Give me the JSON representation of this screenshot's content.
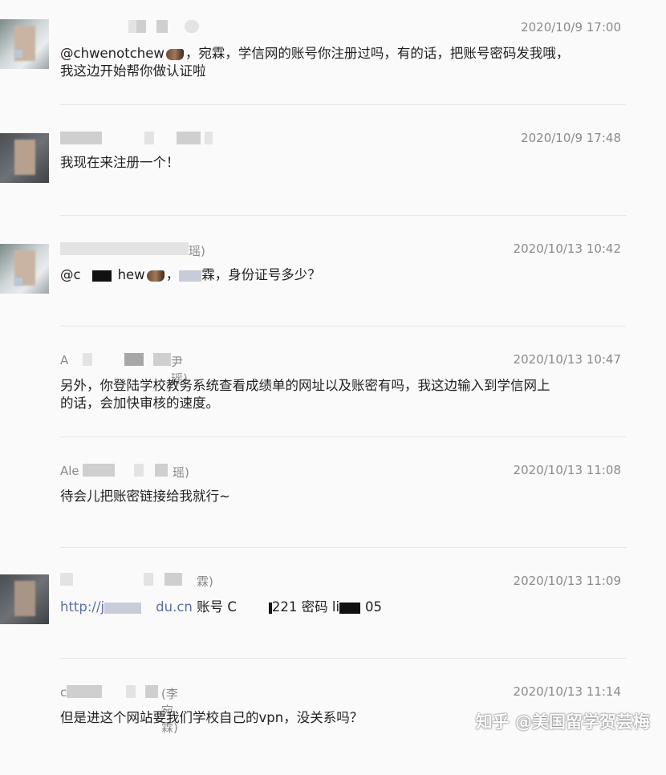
{
  "messages": [
    {
      "time": "2020/10/9 17:00",
      "content_parts": [
        "@chwenotchew",
        "，宛霖，学信网的账号你注册过吗，有的话，把账号密码发我哦，\n我这边开始帮你做认证啦"
      ]
    },
    {
      "time": "2020/10/9 17:48",
      "content": "我现在来注册一个！"
    },
    {
      "sender_visible": "瑶)",
      "time": "2020/10/13 10:42",
      "content_parts": [
        "@c",
        "hew",
        "，",
        "霖，身份证号多少？"
      ]
    },
    {
      "sender_prefix": "A",
      "sender_suffix": "尹瑶)",
      "time": "2020/10/13 10:47",
      "content": "另外，你登陆学校教务系统查看成绩单的网址以及账密有吗，我这边输入到学信网上\n的话，会加快审核的速度。"
    },
    {
      "sender_prefix": "Ale",
      "sender_suffix": "瑶)",
      "time": "2020/10/13 11:08",
      "content": "待会儿把账密链接给我就行~"
    },
    {
      "sender_suffix": "霖)",
      "time": "2020/10/13 11:09",
      "content_parts": [
        "http://j",
        "du.cn",
        " 账号 C",
        "221 密码 li",
        "05"
      ]
    },
    {
      "sender_prefix": "c",
      "sender_suffix": "(李宛霖)",
      "time": "2020/10/13 11:14",
      "content": "但是进这个网站要我们学校自己的vpn，没关系吗？"
    }
  ],
  "watermark": "知乎 @美国留学贺芸梅",
  "icons": {
    "emoji": "shoe-emoji-icon"
  }
}
